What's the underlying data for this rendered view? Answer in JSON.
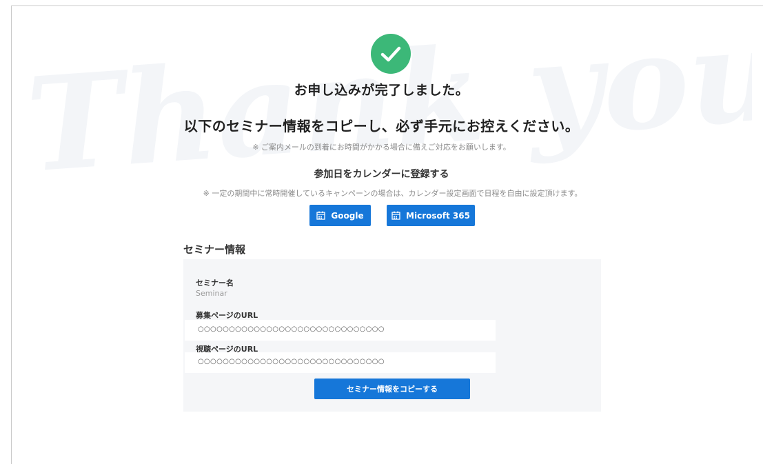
{
  "header": {
    "title_line1": "お申し込みが完了しました。",
    "title_line2": "以下のセミナー情報をコピーし、必ず手元にお控えください。",
    "mail_note": "※ ご案内メールの到着にお時間がかかる場合に備えご対応をお願いします。",
    "watermark_text": "Thank you!"
  },
  "calendar": {
    "heading": "参加日をカレンダーに登録する",
    "note": "※ 一定の期間中に常時開催しているキャンペーンの場合は、カレンダー設定画面で日程を自由に設定頂けます。",
    "google_label": "Google",
    "microsoft_label": "Microsoft 365"
  },
  "seminar": {
    "section_title": "セミナー情報",
    "name_label": "セミナー名",
    "name_value": "Seminar",
    "recruit_url_label": "募集ページのURL",
    "recruit_url_value": "○○○○○○○○○○○○○○○○○○○○○○○○○○○○○○",
    "view_url_label": "視聴ページのURL",
    "view_url_value": "○○○○○○○○○○○○○○○○○○○○○○○○○○○○○○",
    "copy_button": "セミナー情報をコピーする"
  },
  "colors": {
    "accent_blue": "#1677d9",
    "success_green": "#3cb878",
    "panel_bg": "#f5f6f8"
  },
  "icons": [
    "check-icon",
    "calendar-icon"
  ]
}
